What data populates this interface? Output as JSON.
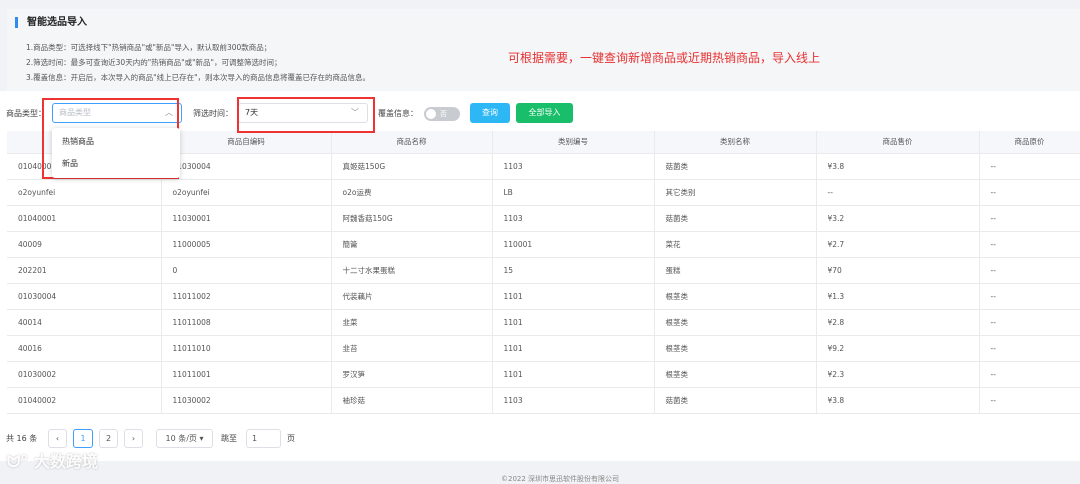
{
  "info": {
    "title": "智能选品导入",
    "line1": "1.商品类型：可选择线下\"热销商品\"或\"新品\"导入，默认取前300款商品；",
    "line2": "2.筛选时间：最多可查询近30天内的\"热销商品\"或\"新品\"，可调整筛选时间；",
    "line3": "3.覆盖信息：开启后，本次导入的商品\"线上已存在\"，则本次导入的商品信息将覆盖已存在的商品信息。",
    "annotation": "可根据需要，一键查询新增商品或近期热销商品，导入线上"
  },
  "filters": {
    "type_label": "商品类型：",
    "type_placeholder": "商品类型",
    "time_label": "筛选时间：",
    "time_value": "7天",
    "overwrite_label": "覆盖信息：",
    "overwrite_toggle_text": "否",
    "query_button": "查询",
    "import_all_button": "全部导入"
  },
  "dropdown": {
    "options": [
      "热销商品",
      "新品"
    ]
  },
  "table": {
    "columns": [
      "",
      "商品自编码",
      "商品名称",
      "类别编号",
      "类别名称",
      "商品售价",
      "商品原价"
    ],
    "rows": [
      [
        "01040001",
        "11030004",
        "真姬菇150G",
        "1103",
        "菇菌类",
        "¥3.8",
        "--"
      ],
      [
        "o2oyunfei",
        "o2oyunfei",
        "o2o运费",
        "LB",
        "其它类别",
        "--",
        "--"
      ],
      [
        "01040001",
        "11030001",
        "阿魏香菇150G",
        "1103",
        "菇菌类",
        "¥3.2",
        "--"
      ],
      [
        "40009",
        "11000005",
        "簡籥",
        "110001",
        "菜花",
        "¥2.7",
        "--"
      ],
      [
        "202201",
        "0",
        "十二寸水果蛋糕",
        "15",
        "蛋糕",
        "¥70",
        "--"
      ],
      [
        "01030004",
        "11011002",
        "代装藕片",
        "1101",
        "根茎类",
        "¥1.3",
        "--"
      ],
      [
        "40014",
        "11011008",
        "韭菜",
        "1101",
        "根茎类",
        "¥2.8",
        "--"
      ],
      [
        "40016",
        "11011010",
        "韭苔",
        "1101",
        "根茎类",
        "¥9.2",
        "--"
      ],
      [
        "01030002",
        "11011001",
        "罗汉笋",
        "1101",
        "根茎类",
        "¥2.3",
        "--"
      ],
      [
        "01040002",
        "11030002",
        "袖珍菇",
        "1103",
        "菇菌类",
        "¥3.8",
        "--"
      ]
    ]
  },
  "pagination": {
    "total": "共 16 条",
    "prev": "‹",
    "page1": "1",
    "page2": "2",
    "next": "›",
    "page_size": "10 条/页",
    "jump_label": "跳至",
    "jump_value": "1",
    "page_suffix": "页"
  },
  "footer": {
    "copyright": "©2022 深圳市思迅软件股份有限公司"
  },
  "watermark": "大数跨境",
  "colors": {
    "primary": "#409eff",
    "query": "#2db7f5",
    "import": "#19be6b",
    "annotation": "#e83030",
    "highlight_box": "#ee3333"
  }
}
